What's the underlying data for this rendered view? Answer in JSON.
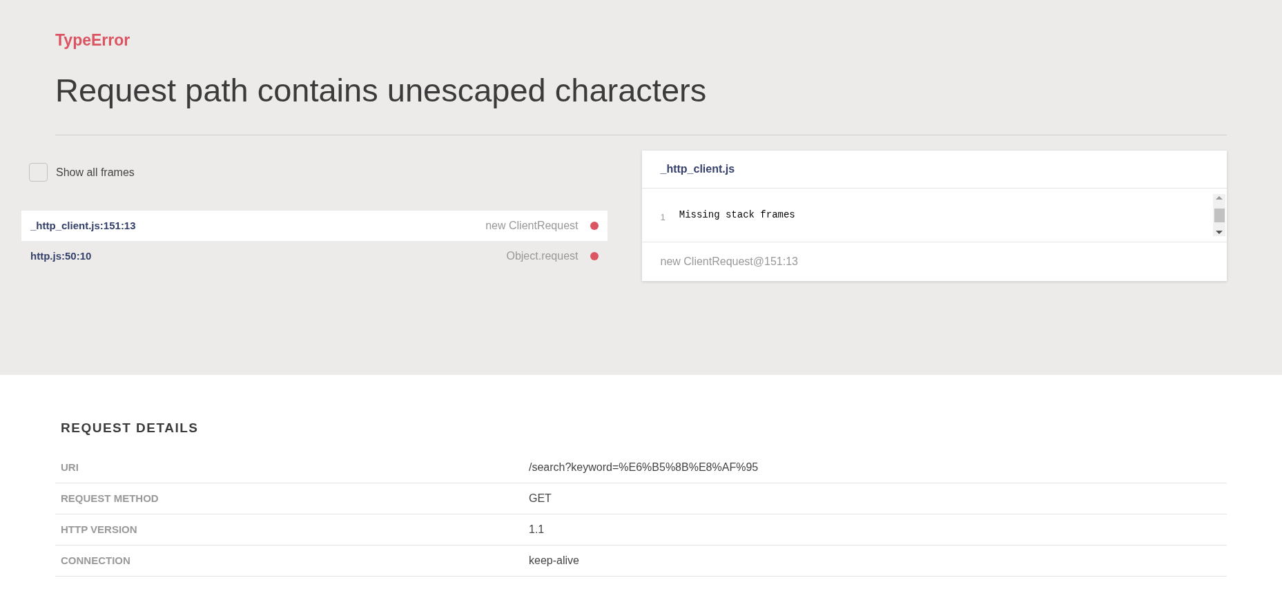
{
  "error": {
    "type": "TypeError",
    "message": "Request path contains unescaped characters"
  },
  "show_all_frames": {
    "label": "Show all frames",
    "checked": false
  },
  "frames": [
    {
      "file": "_http_client.js:151:13",
      "function": "new ClientRequest",
      "selected": true
    },
    {
      "file": "http.js:50:10",
      "function": "Object.request",
      "selected": false
    }
  ],
  "code_panel": {
    "file": "_http_client.js",
    "lines": [
      {
        "number": "1",
        "code": "Missing stack frames"
      }
    ],
    "footer": "new ClientRequest@151:13"
  },
  "request_details": {
    "title": "REQUEST DETAILS",
    "rows": [
      {
        "key": "URI",
        "value": "/search?keyword=%E6%B5%8B%E8%AF%95"
      },
      {
        "key": "REQUEST METHOD",
        "value": "GET"
      },
      {
        "key": "HTTP VERSION",
        "value": "1.1"
      },
      {
        "key": "CONNECTION",
        "value": "keep-alive"
      }
    ]
  }
}
